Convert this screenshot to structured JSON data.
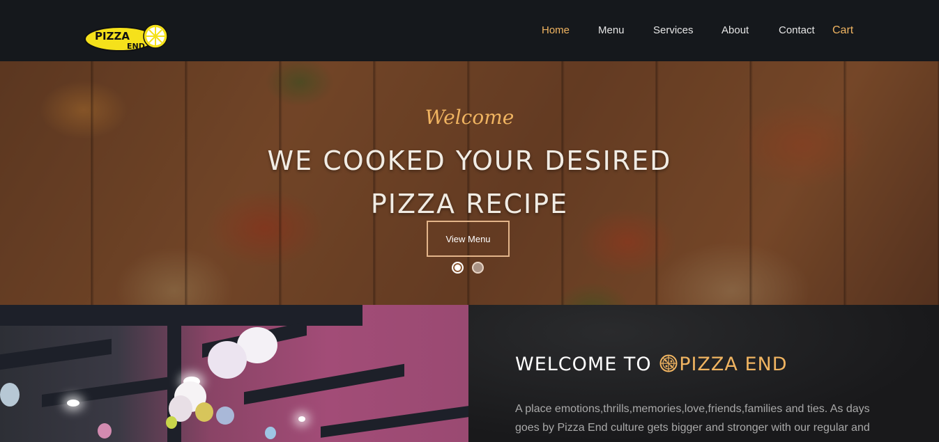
{
  "brand": {
    "logo_line1": "PIZZA",
    "logo_line2": "END"
  },
  "nav": {
    "items": [
      {
        "label": "Home",
        "active": true
      },
      {
        "label": "Menu",
        "active": false
      },
      {
        "label": "Services",
        "active": false
      },
      {
        "label": "About",
        "active": false
      },
      {
        "label": "Contact",
        "active": false
      }
    ],
    "cart_label": "Cart"
  },
  "hero": {
    "welcome": "Welcome",
    "title_line1": "WE COOKED YOUR DESIRED",
    "title_line2": "PIZZA RECIPE",
    "button_label": "View Menu",
    "slides_total": 2,
    "active_slide": 1
  },
  "about": {
    "title_prefix": "WELCOME TO",
    "title_brand": "PIZZA END",
    "text": "A place emotions,thrills,memories,love,friends,families and ties. As days goes by Pizza End culture gets bigger and stronger with our regular and"
  },
  "colors": {
    "accent": "#f0b461",
    "nav_bg": "#15181c",
    "logo_yellow": "#f5e11b"
  }
}
